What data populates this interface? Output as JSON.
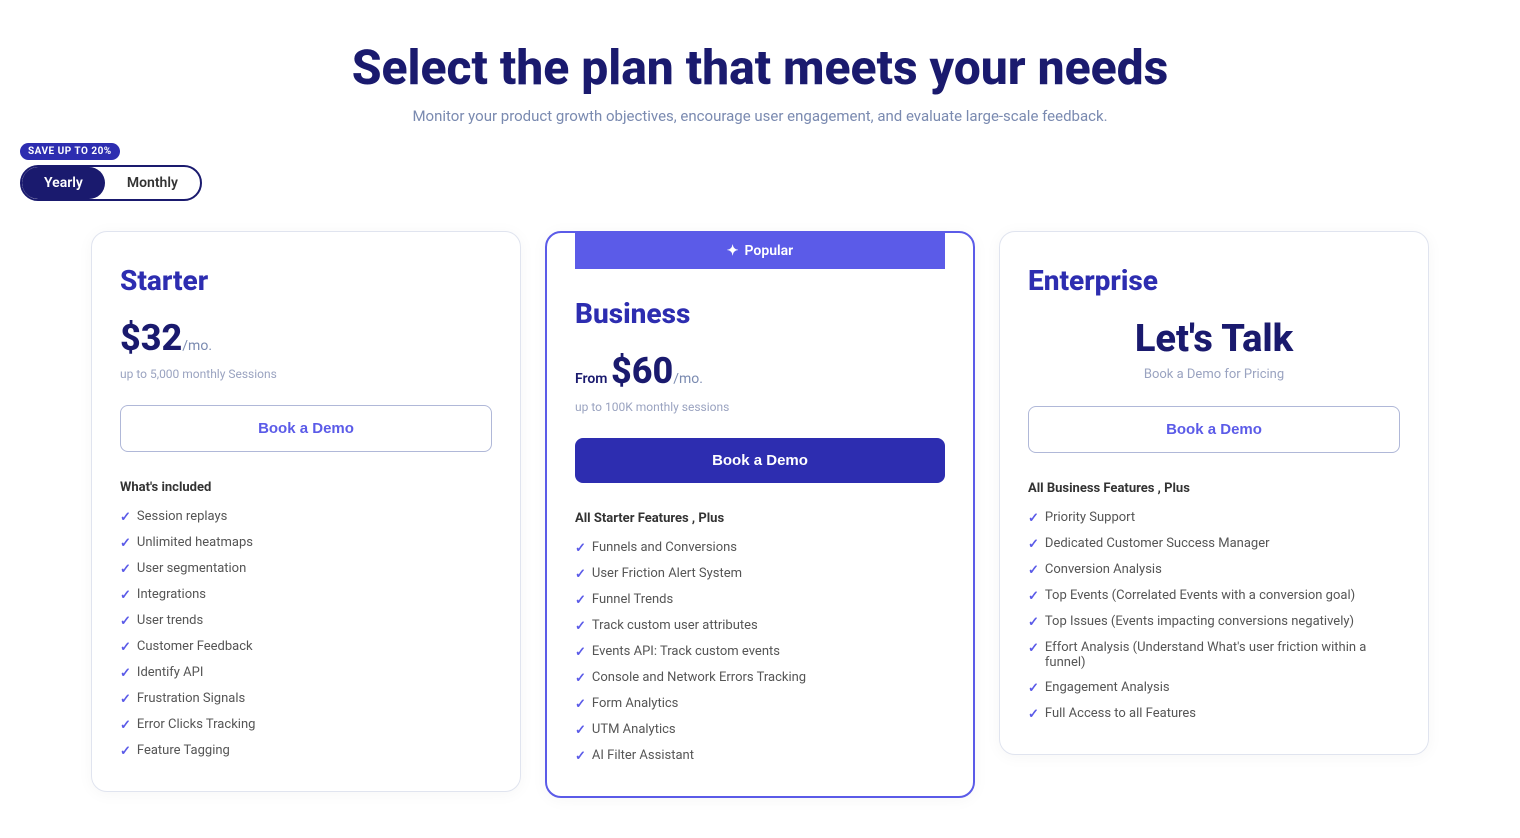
{
  "header": {
    "title": "Select the plan that meets your needs",
    "subtitle": "Monitor your product growth objectives, encourage user engagement, and evaluate large-scale feedback."
  },
  "billing": {
    "save_badge": "SAVE UP TO 20%",
    "yearly_label": "Yearly",
    "monthly_label": "Monthly",
    "active": "yearly"
  },
  "plans": [
    {
      "id": "starter",
      "name": "Starter",
      "price_prefix": "",
      "price": "$32",
      "price_period": "/mo.",
      "price_sessions": "up to 5,000 monthly Sessions",
      "cta_label": "Book a Demo",
      "cta_style": "outline",
      "popular": false,
      "features_heading": "What's included",
      "features": [
        "Session replays",
        "Unlimited heatmaps",
        "User segmentation",
        "Integrations",
        "User trends",
        "Customer Feedback",
        "Identify API",
        "Frustration Signals",
        "Error Clicks Tracking",
        "Feature Tagging"
      ]
    },
    {
      "id": "business",
      "name": "Business",
      "price_prefix": "From ",
      "price": "$60",
      "price_period": "/mo.",
      "price_sessions": "up to 100K monthly sessions",
      "cta_label": "Book a Demo",
      "cta_style": "filled",
      "popular": true,
      "popular_label": "Popular",
      "features_heading": "All Starter Features , Plus",
      "features": [
        "Funnels and Conversions",
        "User Friction Alert System",
        "Funnel Trends",
        "Track custom user attributes",
        "Events API: Track custom events",
        "Console and Network Errors Tracking",
        "Form Analytics",
        "UTM Analytics",
        "AI Filter Assistant"
      ]
    },
    {
      "id": "enterprise",
      "name": "Enterprise",
      "price_prefix": "",
      "price": "Let's Talk",
      "price_period": "",
      "price_sessions": "",
      "price_sub": "Book a Demo for Pricing",
      "cta_label": "Book a Demo",
      "cta_style": "outline",
      "popular": false,
      "features_heading": "All Business Features , Plus",
      "features": [
        "Priority Support",
        "Dedicated Customer Success Manager",
        "Conversion Analysis",
        "Top Events (Correlated Events with a conversion goal)",
        "Top Issues (Events impacting conversions negatively)",
        "Effort Analysis (Understand What's user friction within a funnel)",
        "Engagement Analysis",
        "Full Access to all Features"
      ]
    }
  ]
}
